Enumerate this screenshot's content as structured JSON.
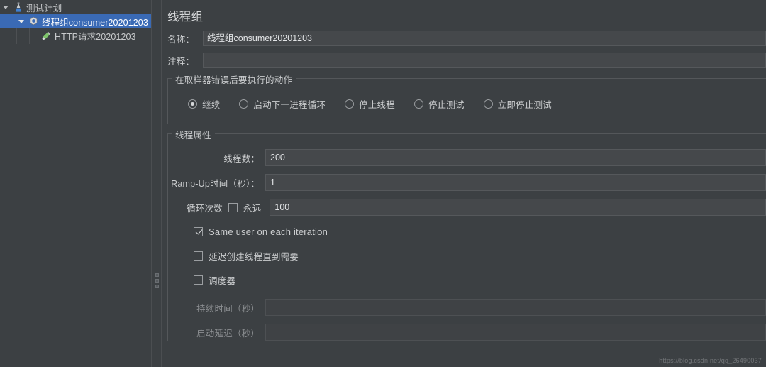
{
  "tree": {
    "nodes": [
      {
        "label": "测试计划",
        "icon": "test-plan-icon",
        "selected": false,
        "depth": 0,
        "expanded": true
      },
      {
        "label": "线程组consumer20201203",
        "icon": "thread-group-gear-icon",
        "selected": true,
        "depth": 1,
        "expanded": true
      },
      {
        "label": "HTTP请求20201203",
        "icon": "http-request-pen-icon",
        "selected": false,
        "depth": 2,
        "expanded": false
      }
    ]
  },
  "panel": {
    "title": "线程组",
    "name_label": "名称：",
    "name_value": "线程组consumer20201203",
    "comment_label": "注释：",
    "comment_value": "",
    "comment_placeholder": ""
  },
  "error_action": {
    "group_title": "在取样器错误后要执行的动作",
    "options": [
      {
        "label": "继续",
        "selected": true
      },
      {
        "label": "启动下一进程循环",
        "selected": false
      },
      {
        "label": "停止线程",
        "selected": false
      },
      {
        "label": "停止测试",
        "selected": false
      },
      {
        "label": "立即停止测试",
        "selected": false
      }
    ]
  },
  "thread_properties": {
    "group_title": "线程属性",
    "num_threads_label": "线程数：",
    "num_threads_value": "200",
    "ramp_up_label": "Ramp-Up时间（秒）：",
    "ramp_up_value": "1",
    "loop_count_label": "循环次数",
    "forever_label": "永远",
    "forever_checked": false,
    "loop_count_value": "100",
    "same_user_label": "Same user on each iteration",
    "same_user_checked": true,
    "delayed_start_label": "延迟创建线程直到需要",
    "delayed_start_checked": false,
    "scheduler_label": "调度器",
    "scheduler_checked": false,
    "duration_label": "持续时间（秒）",
    "duration_value": "",
    "startup_delay_label": "启动延迟（秒）",
    "startup_delay_value": ""
  },
  "watermark": {
    "line1": "https://blog.csdn.net/qq_26490037",
    "line2": "https://blog.csdn.net/qq_26490037"
  },
  "colors": {
    "panel_bg": "#3c4043",
    "selection_blue": "#3a6ab5",
    "input_bg": "#45484b",
    "text": "#cbcdcf"
  }
}
